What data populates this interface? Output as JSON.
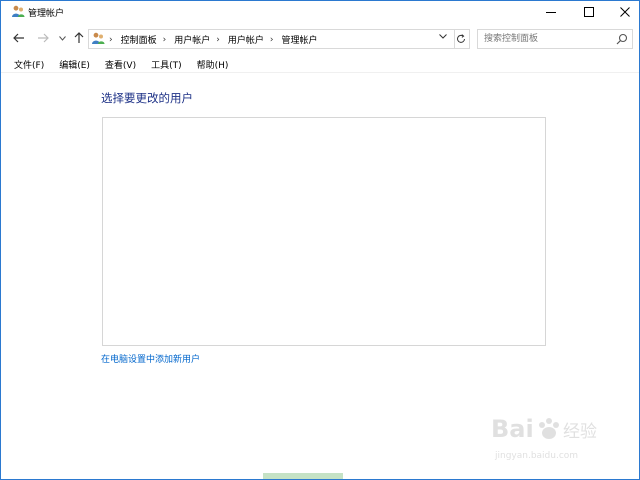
{
  "window": {
    "title": "管理帐户",
    "controls": {
      "minimize": "minimize",
      "maximize": "maximize",
      "close": "close"
    }
  },
  "navigation": {
    "breadcrumbs": [
      "控制面板",
      "用户帐户",
      "用户帐户",
      "管理帐户"
    ],
    "search_placeholder": "搜索控制面板"
  },
  "menu": {
    "items": [
      "文件(F)",
      "编辑(E)",
      "查看(V)",
      "工具(T)",
      "帮助(H)"
    ]
  },
  "main": {
    "heading": "选择要更改的用户",
    "add_user_link": "在电脑设置中添加新用户"
  },
  "watermark": {
    "brand": "Bai",
    "brand2": "经验",
    "url": "jingyan.baidu.com"
  },
  "colors": {
    "heading": "#1e3287",
    "link": "#0066cc",
    "window_border": "#2b79d0"
  }
}
